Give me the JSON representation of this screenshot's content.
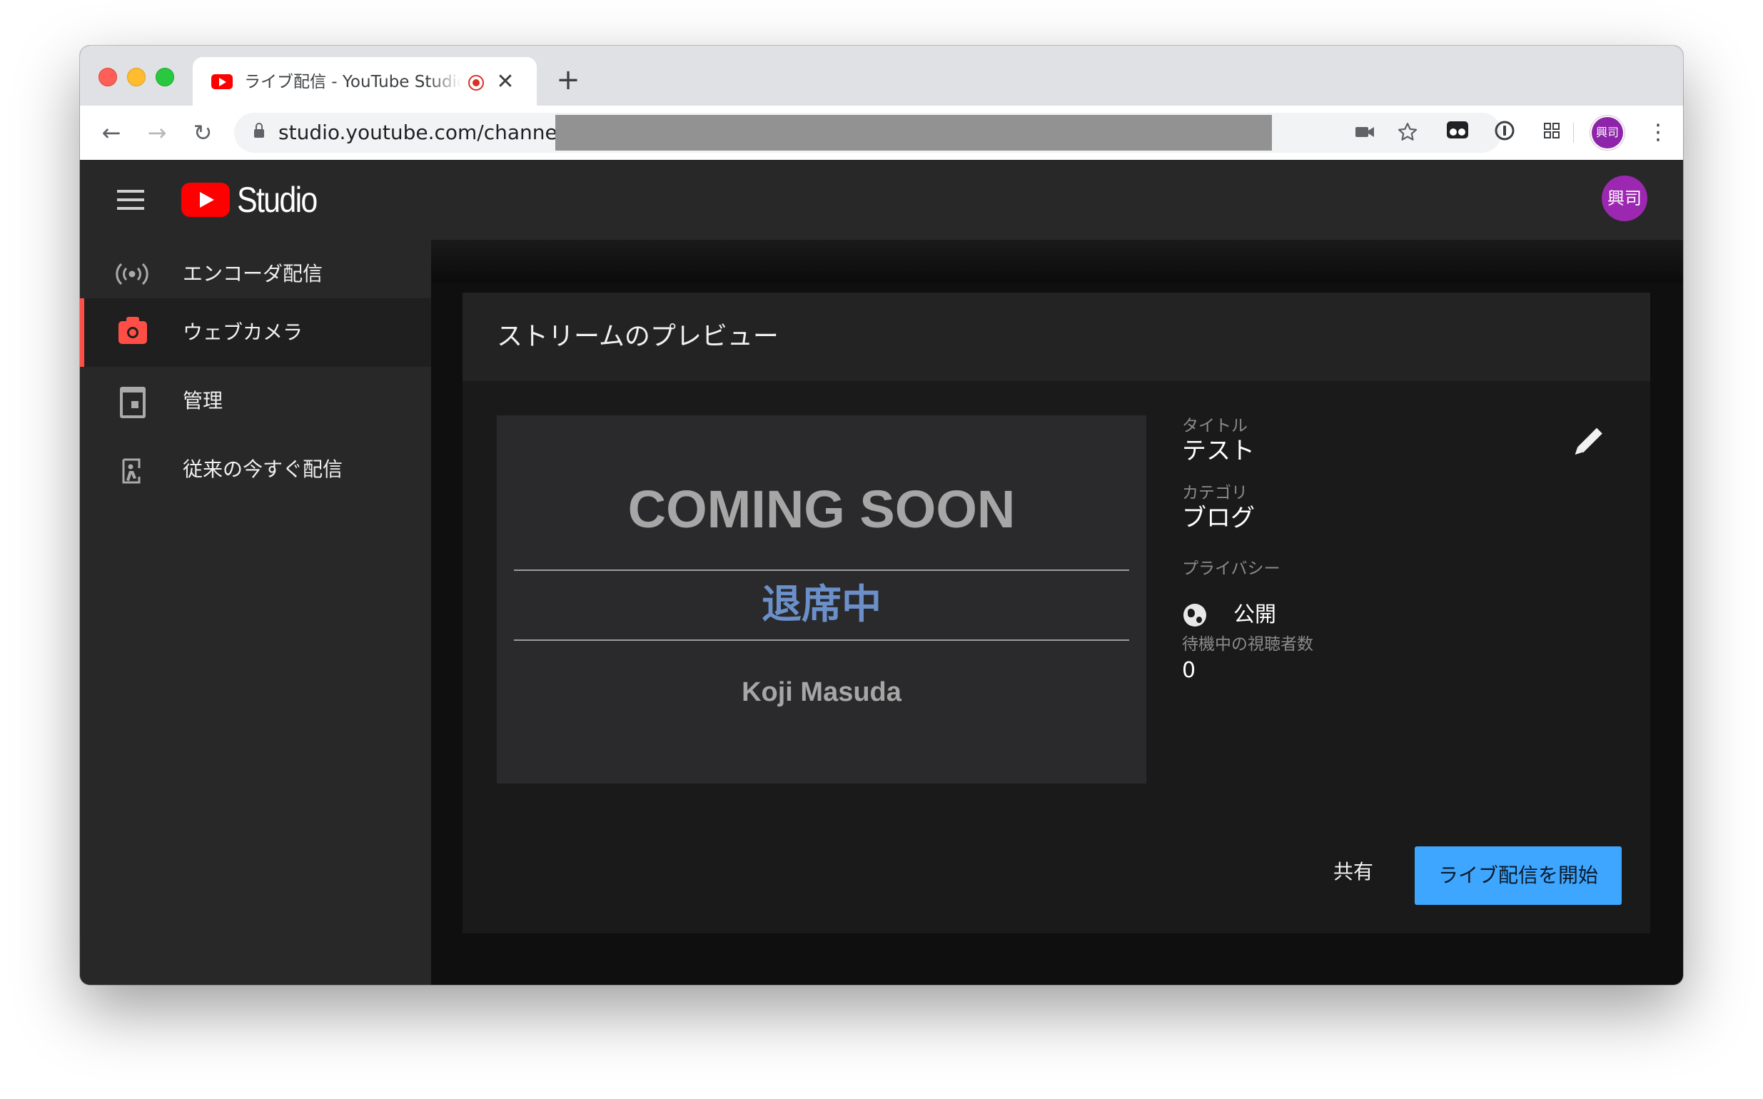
{
  "browser": {
    "tab_title": "ライブ配信 - YouTube Studio",
    "tab_close": "✕",
    "new_tab": "+",
    "url": "studio.youtube.com/channel/",
    "back": "←",
    "forward": "→",
    "reload": "↻",
    "profile_initials": "興司",
    "menu": "⋮"
  },
  "header": {
    "logo_text": "Studio",
    "avatar_initials": "興司"
  },
  "sidebar": {
    "items": [
      {
        "label": "エンコーダ配信",
        "icon": "broadcast-icon"
      },
      {
        "label": "ウェブカメラ",
        "icon": "camera-icon",
        "active": true
      },
      {
        "label": "管理",
        "icon": "calendar-icon"
      },
      {
        "label": "従来の今すぐ配信",
        "icon": "classic-stream-icon"
      }
    ]
  },
  "card": {
    "title": "ストリームのプレビュー",
    "preview": {
      "headline": "COMING SOON",
      "status": "退席中",
      "name": "Koji Masuda"
    },
    "info": {
      "title_label": "タイトル",
      "title_value": "テスト",
      "category_label": "カテゴリ",
      "category_value": "ブログ",
      "privacy_label": "プライバシー",
      "privacy_value": "公開",
      "waiting_label": "待機中の視聴者数",
      "waiting_value": "0"
    },
    "share_label": "共有",
    "go_live_label": "ライブ配信を開始"
  },
  "colors": {
    "accent_red": "#ff4e45",
    "youtube_red": "#ff0000",
    "primary_button": "#3ea6ff",
    "status_blue": "#6b90c9",
    "avatar_purple": "#9c27b0"
  }
}
